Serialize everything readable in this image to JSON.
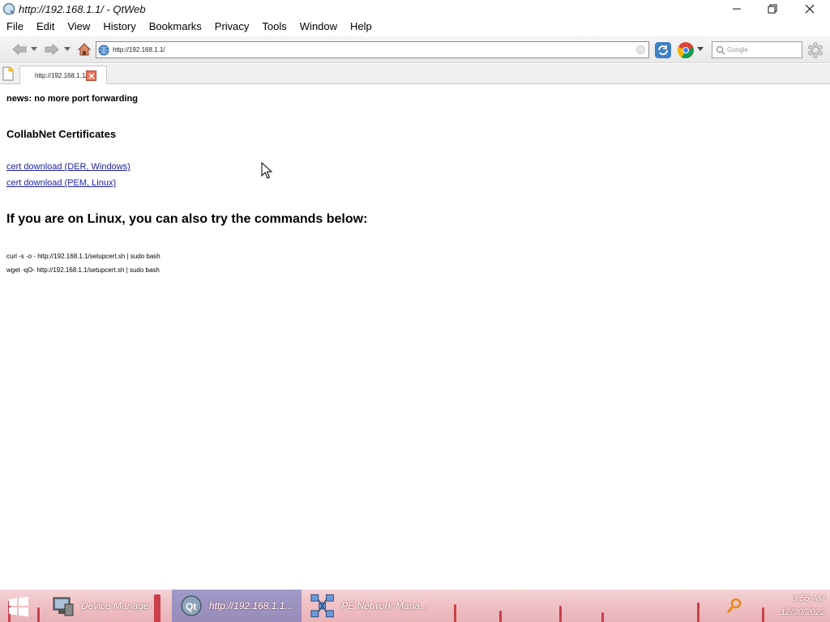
{
  "window": {
    "title": "http://192.168.1.1/ - QtWeb"
  },
  "menu": [
    "File",
    "Edit",
    "View",
    "History",
    "Bookmarks",
    "Privacy",
    "Tools",
    "Window",
    "Help"
  ],
  "toolbar": {
    "url": "http://192.168.1.1/",
    "search_placeholder": "Google"
  },
  "tab": {
    "label": "http://192.168.1.1/"
  },
  "content": {
    "news": "news: no more port forwarding",
    "heading_cert": "CollabNet Certificates",
    "link_der": "cert download (DER, Windows)",
    "link_pem": "cert download (PEM, Linux)",
    "heading_linux": "If you are on Linux, you can also try the commands below:",
    "cmd_curl": "curl -s -o - http://192.168.1.1/setupcert.sh | sudo bash",
    "cmd_wget": "wget -qO- http://192.168.1.1/setupcert.sh | sudo bash"
  },
  "taskbar": {
    "items": [
      "Device Manager",
      "http://192.168.1.1...",
      "PE Network Mana..."
    ],
    "time": "3:55 AM",
    "date": "12/30/2022"
  }
}
